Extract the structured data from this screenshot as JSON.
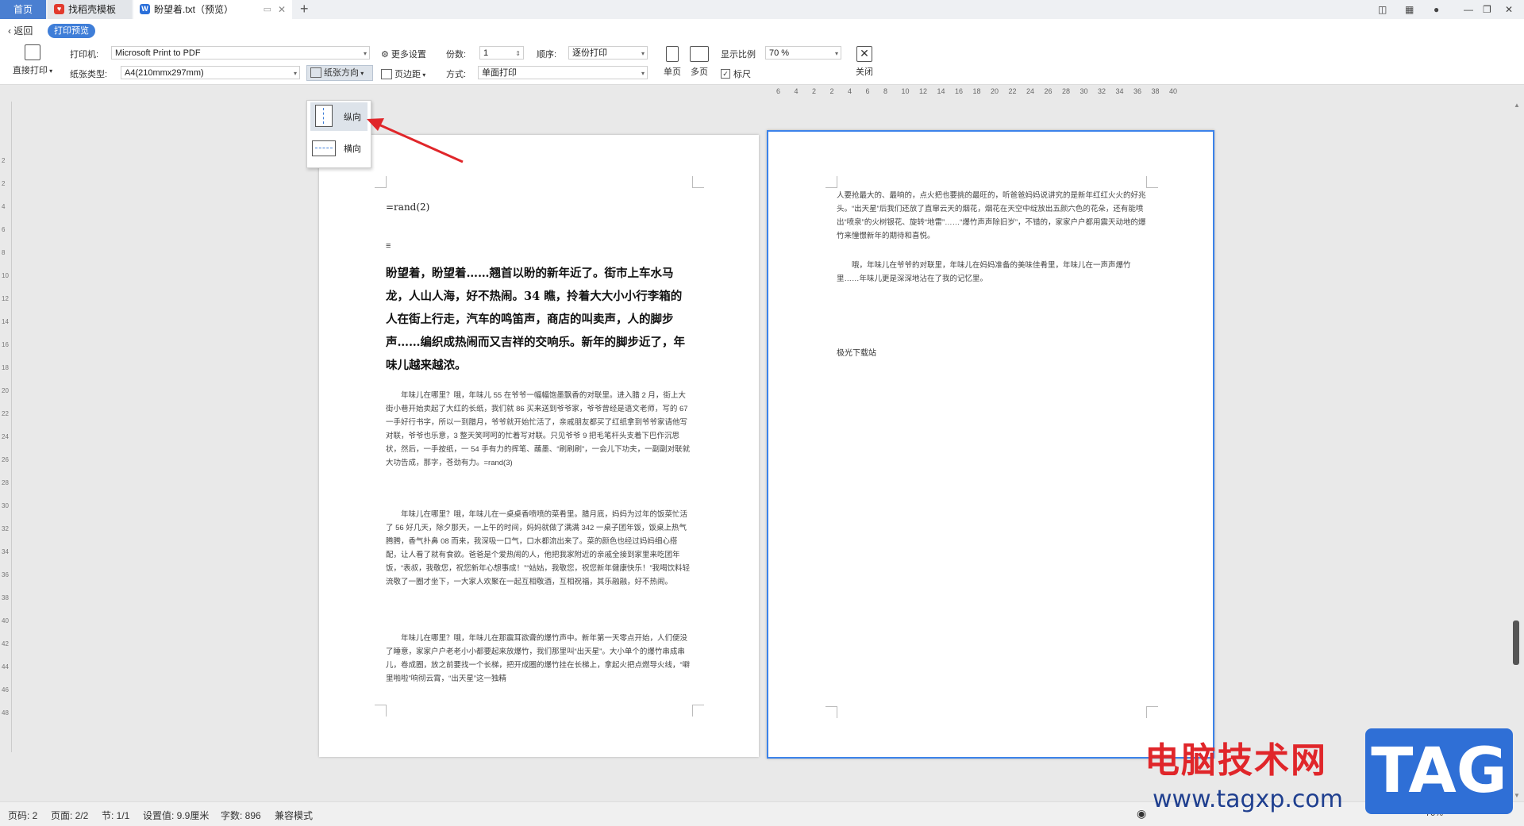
{
  "tabs": {
    "home": "首页",
    "template": "找稻壳模板",
    "doc": "盼望着.txt（预览）",
    "new": "+"
  },
  "nav": {
    "back": "返回",
    "mode": "打印预览"
  },
  "toolbar": {
    "direct_print": "直接打印",
    "printer_label": "打印机:",
    "printer_value": "Microsoft Print to PDF",
    "more_settings": "更多设置",
    "copies_label": "份数:",
    "copies_value": "1",
    "order_label": "顺序:",
    "order_value": "逐份打印",
    "paper_label": "纸张类型:",
    "paper_value": "A4(210mmx297mm)",
    "orientation": "纸张方向",
    "margin": "页边距",
    "mode_label": "方式:",
    "mode_value": "单面打印",
    "single_page": "单页",
    "multi_page": "多页",
    "zoom_label": "显示比例",
    "zoom_value": "70 %",
    "ruler": "标尺",
    "close": "关闭"
  },
  "orientation_menu": {
    "portrait": "纵向",
    "landscape": "横向"
  },
  "ruler_top": [
    "6",
    "4",
    "2",
    "2",
    "4",
    "6",
    "8",
    "10",
    "12",
    "14",
    "16",
    "18",
    "20",
    "22",
    "24",
    "26",
    "28",
    "30",
    "32",
    "34",
    "36",
    "38",
    "40"
  ],
  "ruler_left": [
    "2",
    "2",
    "4",
    "6",
    "8",
    "10",
    "12",
    "14",
    "16",
    "18",
    "20",
    "22",
    "24",
    "26",
    "28",
    "30",
    "32",
    "34",
    "36",
    "38",
    "40",
    "42",
    "44",
    "46",
    "48"
  ],
  "page1": {
    "rand": "=rand(2)",
    "mark": "≡",
    "heading": "盼望着，盼望着……翘首以盼的新年近了。街市上车水马龙，人山人海，好不热闹。34 瞧，拎着大大小小行李箱的人在街上行走，汽车的鸣笛声，商店的叫卖声，人的脚步声……编织成热闹而又吉祥的交响乐。新年的脚步近了，年味儿越来越浓。",
    "p1": "年味儿在哪里？哦，年味儿 55 在爷爷一幅幅饱墨飘香的对联里。进入腊 2 月，街上大街小巷开始卖起了大红的长纸，我们就 86 买来送到爷爷家，爷爷曾经是语文老师，写的 67 一手好行书字，所以一到腊月，爷爷就开始忙活了，亲戚朋友都买了红纸拿到爷爷家请他写对联，爷爷也乐意，3 整天笑呵呵的忙着写对联。只见爷爷 9 把毛笔杆头支着下巴作沉思状，然后，一手按纸，一 54 手有力的挥笔、蘸墨、“刷刷刷”，一会儿下功夫，一副副对联就大功告成，那字，苍劲有力。=rand(3)",
    "p2": "年味儿在哪里？哦，年味儿在一桌桌香喷喷的菜肴里。腊月底，妈妈为过年的饭菜忙活了 56 好几天，除夕那天，一上午的时间，妈妈就做了满满 342 一桌子团年饭，饭桌上热气腾腾，香气扑鼻 08 而来，我深吸一口气，口水都流出来了。菜的颜色也经过妈妈细心搭配，让人看了就有食欲。爸爸是个爱热闹的人，他把我家附近的亲戚全接到家里来吃团年饭，“表叔，我敬您，祝您新年心想事成！”“姑姑，我敬您，祝您新年健康快乐！”我喝饮料轻流敬了一圈才坐下，一大家人欢聚在一起互相敬酒，互相祝福，其乐融融，好不热闹。",
    "p3": "年味儿在哪里？哦，年味儿在那震耳欲聋的爆竹声中。新年第一天零点开始，人们便没了睡意，家家户户老老小小都要起来放爆竹，我们那里叫“出天星”。大小单个的爆竹串成串儿，卷成圈，放之前要找一个长梯，把开成圈的爆竹挂在长梯上，拿起火把点燃导火线，“噼里啪啦”响彻云霄，“出天星”这一独精"
  },
  "page2": {
    "p1": "人要抢最大的、最响的，点火把也要挑的最旺的，听爸爸妈妈说讲究的是新年红红火火的好兆头。“出天星”后我们还放了直窜云天的烟花，烟花在天空中绽放出五颜六色的花朵，还有能喷出“喷泉”的火树银花、旋转“地雷”……“爆竹声声除旧岁”，不错的，家家户户都用震天动地的爆竹来憧憬新年的期待和喜悦。",
    "p2": "哦，年味儿在爷爷的对联里，年味儿在妈妈准备的美味佳肴里，年味儿在一声声爆竹里……年味儿更是深深地沾在了我的记忆里。",
    "footer": "极光下载站"
  },
  "status": {
    "page_no": "页码: 2",
    "pages": "页面: 2/2",
    "section": "节: 1/1",
    "setting": "设置值: 9.9厘米",
    "words": "字数: 896",
    "compat": "兼容模式",
    "zoom": "70%"
  },
  "watermark": {
    "line1": "电脑技术网",
    "line2": "www.tagxp.com",
    "tag": "TAG"
  },
  "colors": {
    "accent": "#3f7ed8",
    "arrow": "#e0262a",
    "selected_page_border": "#3c83ea"
  }
}
